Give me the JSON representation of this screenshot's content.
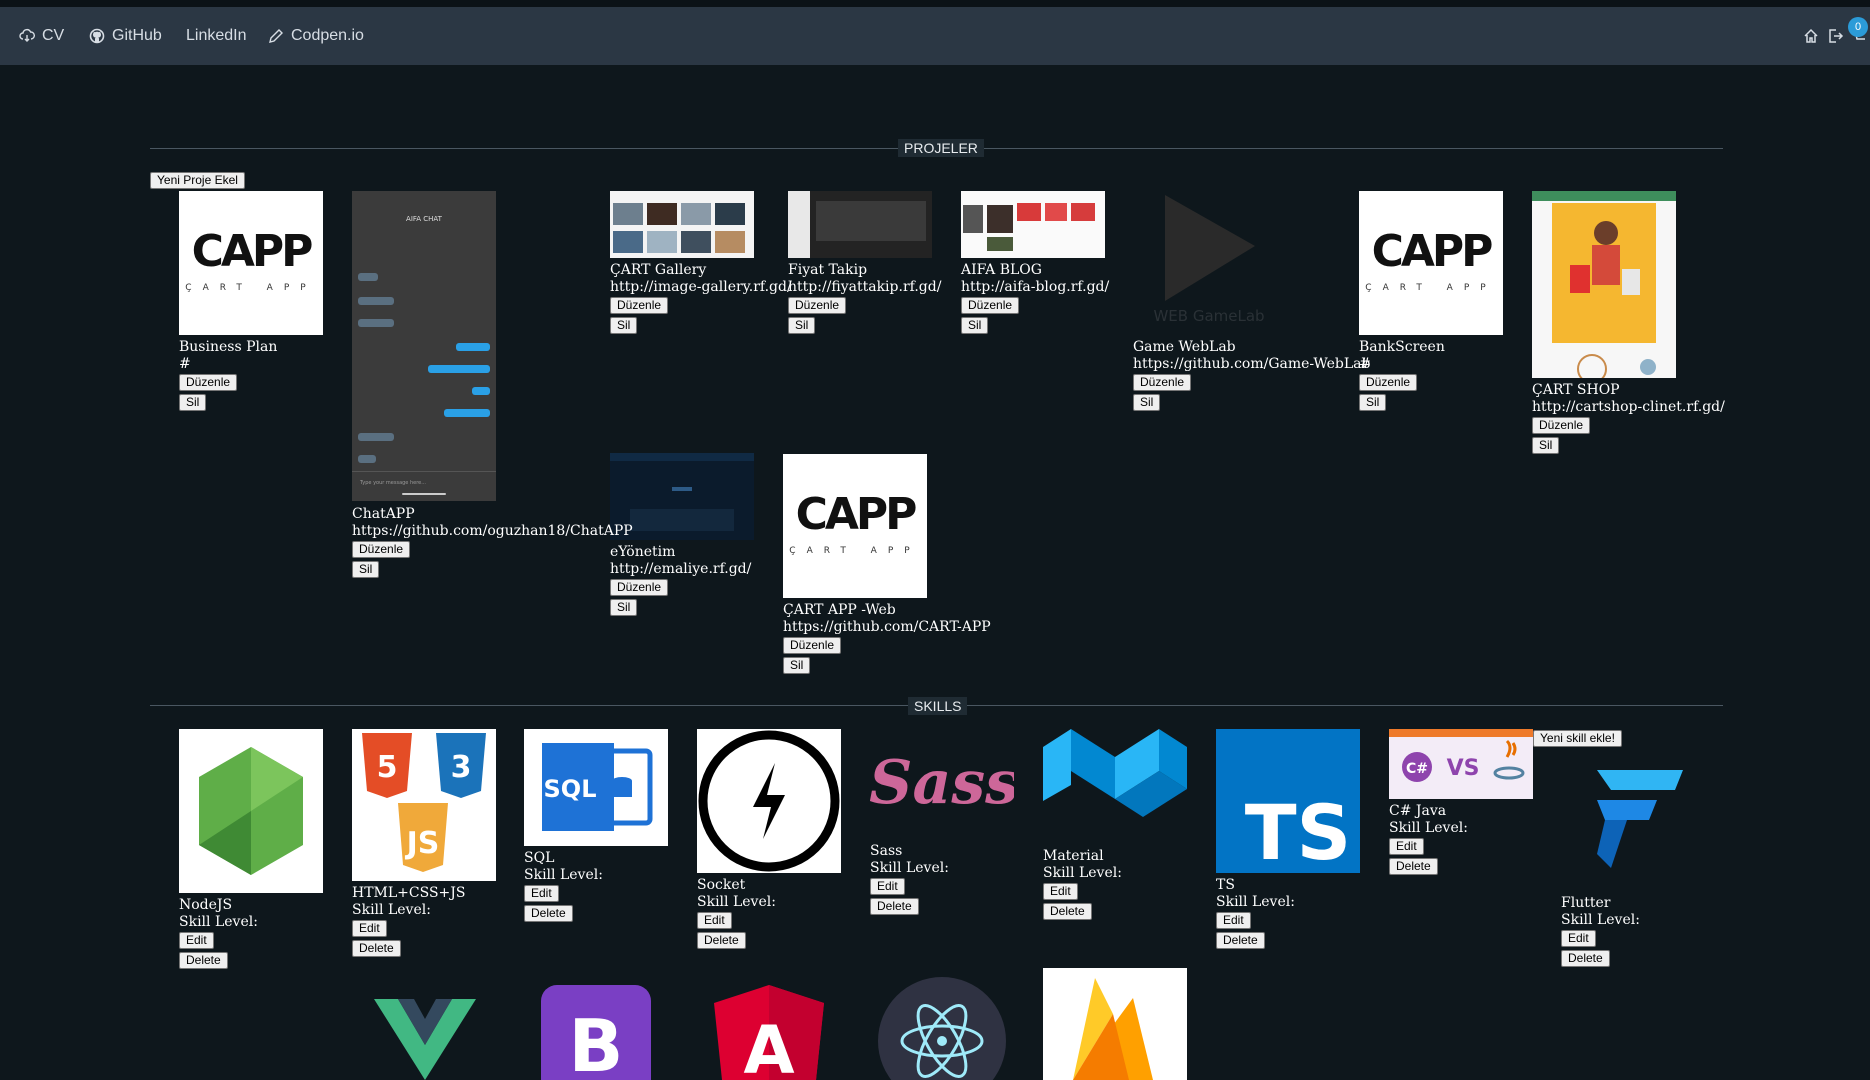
{
  "nav": {
    "cv": "CV",
    "github": "GitHub",
    "linkedin": "LinkedIn",
    "codepen": "Codpen.io",
    "badge_count": "0"
  },
  "projects": {
    "title": "PROJELER",
    "add_label": "Yeni Proje Ekel",
    "edit_label": "Düzenle",
    "delete_label": "Sil",
    "items": [
      {
        "name": "Business Plan",
        "url": "#"
      },
      {
        "name": "ChatAPP",
        "url": "https://github.com/oguzhan18/ChatAPP"
      },
      {
        "name": "ÇART Gallery",
        "url": "http://image-gallery.rf.gd/"
      },
      {
        "name": "Fiyat Takip",
        "url": "http://fiyattakip.rf.gd/"
      },
      {
        "name": "AIFA BLOG",
        "url": "http://aifa-blog.rf.gd/"
      },
      {
        "name": "Game WebLab",
        "url": "https://github.com/Game-WebLab"
      },
      {
        "name": "BankScreen",
        "url": "#"
      },
      {
        "name": "ÇART SHOP",
        "url": "http://cartshop-clinet.rf.gd/"
      },
      {
        "name": "eYönetim",
        "url": "http://emaliye.rf.gd/"
      },
      {
        "name": "ÇART APP -Web",
        "url": "https://github.com/CART-APP"
      }
    ],
    "capp_logo_text": "CAPP",
    "capp_logo_sub": "ÇART APP",
    "chat_title": "AIFA CHAT",
    "chat_input_placeholder": "Type your message here...",
    "gamelab_watermark": "WEB GameLab"
  },
  "skills": {
    "title": "SKILLS",
    "add_label": "Yeni skill ekle!",
    "level_label": "Skill Level:",
    "edit_label": "Edit",
    "delete_label": "Delete",
    "items": [
      {
        "name": "NodeJS",
        "icon": "nodejs-icon"
      },
      {
        "name": "HTML+CSS+JS",
        "icon": "html-css-js-icon"
      },
      {
        "name": "SQL",
        "icon": "sql-icon"
      },
      {
        "name": "Socket",
        "icon": "socket-icon"
      },
      {
        "name": "Sass",
        "icon": "sass-icon"
      },
      {
        "name": "Material",
        "icon": "material-icon"
      },
      {
        "name": "TS",
        "icon": "typescript-icon"
      },
      {
        "name": "C# Java",
        "icon": "csharp-java-icon"
      },
      {
        "name": "Flutter",
        "icon": "flutter-icon"
      }
    ],
    "more_icons": [
      "vue-icon",
      "bootstrap-icon",
      "angular-icon",
      "electron-icon",
      "firebase-icon"
    ]
  },
  "colors": {
    "background": "#0e171c",
    "navbar": "#2b3744",
    "badge": "#2b9bd8"
  }
}
